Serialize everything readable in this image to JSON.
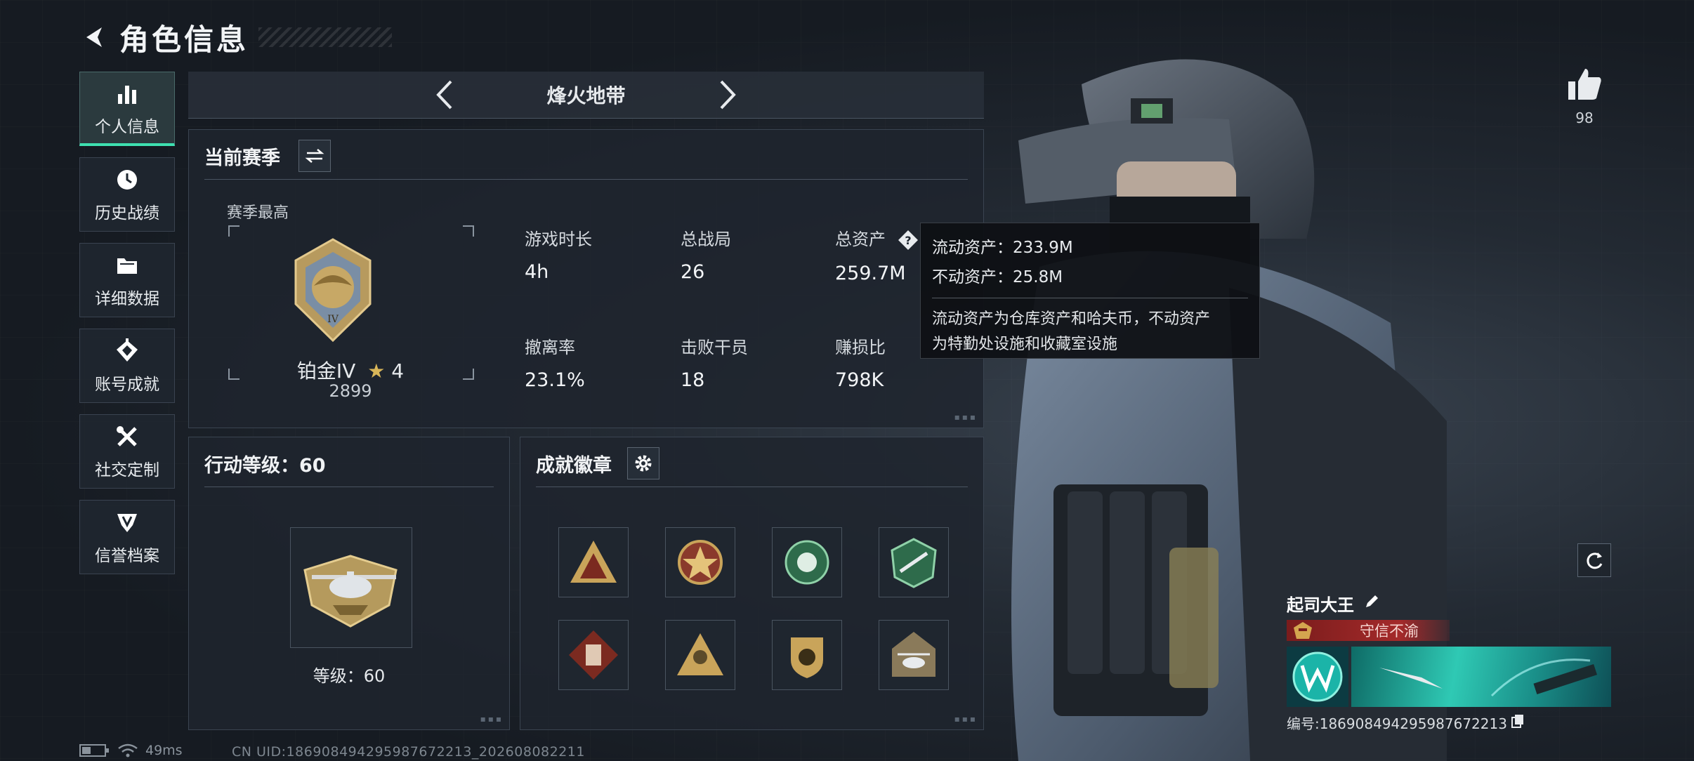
{
  "header": {
    "title": "角色信息"
  },
  "nav": {
    "items": [
      {
        "label": "个人信息",
        "icon": "bar-chart-icon"
      },
      {
        "label": "历史战绩",
        "icon": "history-clock-icon"
      },
      {
        "label": "详细数据",
        "icon": "folder-icon"
      },
      {
        "label": "账号成就",
        "icon": "achievement-icon"
      },
      {
        "label": "社交定制",
        "icon": "tools-icon"
      },
      {
        "label": "信誉档案",
        "icon": "reputation-icon"
      }
    ]
  },
  "mode": {
    "title": "烽火地带"
  },
  "season": {
    "title": "当前赛季",
    "best_label": "赛季最高",
    "rank_name": "铂金IV",
    "rank_stars": "4",
    "rank_score": "2899",
    "stats": [
      {
        "label": "游戏时长",
        "value": "4h"
      },
      {
        "label": "总战局",
        "value": "26"
      },
      {
        "label": "总资产",
        "value": "259.7M"
      },
      {
        "label": "撤离率",
        "value": "23.1%"
      },
      {
        "label": "击败干员",
        "value": "18"
      },
      {
        "label": "赚损比",
        "value": "798K"
      }
    ]
  },
  "tooltip": {
    "liquid": "流动资产：233.9M",
    "fixed": "不动资产：25.8M",
    "note_1": "流动资产为仓库资产和哈夫币，不动资产",
    "note_2": "为特勤处设施和收藏室设施"
  },
  "level": {
    "title": "行动等级：60",
    "text": "等级：60"
  },
  "achievements": {
    "title": "成就徽章"
  },
  "likes": {
    "count": "98"
  },
  "player": {
    "name": "起司大王",
    "title": "守信不渝",
    "id": "编号:186908494295987672213"
  },
  "status": {
    "ping": "49ms",
    "uid": "CN UID:186908494295987672213_202608082211"
  },
  "colors": {
    "accent": "#3ee0b0",
    "title_red": "#a42a2a"
  }
}
